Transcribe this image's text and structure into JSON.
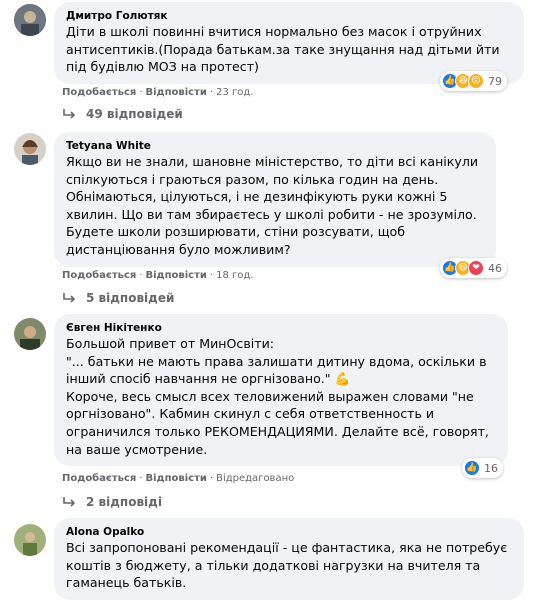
{
  "comments": [
    {
      "author": "Дмитро Голютяк",
      "text": "Діти в школі повинні вчитися нормально без масок і отруйних антисептиків.(Порада батькам.за таке знущання над дітьми йти під будівлю МОЗ на протест)",
      "like_label": "Подобається",
      "reply_label": "Відповісти",
      "time": "23 год.",
      "reaction_count": "79",
      "reactions": [
        "like",
        "haha",
        "wow"
      ],
      "replies_label": "49 відповідей"
    },
    {
      "author": "Tetyana White",
      "text": "Якщо ви не знали, шановне міністерство, то діти всі канікули спілкуються і граються разом, по кілька годин на день. Обнімаються, цілуються, і не дезинфікують руки кожні 5 хвилин. Що ви там збираєтесь у школі робити - не зрозуміло. Будете школи розширювати, стіни розсувати, щоб дистанціювання було можливим?",
      "like_label": "Подобається",
      "reply_label": "Відповісти",
      "time": "18 год.",
      "reaction_count": "46",
      "reactions": [
        "like",
        "haha",
        "love"
      ],
      "replies_label": "5 відповідей"
    },
    {
      "author": "Євген Нікітенко",
      "text": "Большой привет от МинОсвіти:\n\"... батьки не мають права залишати дитину вдома, оскільки в інший спосіб навчання не оргнізовано.\" 💪\nКороче, весь смысл всех теловижений выражен словами \"не оргнізовано\". Кабмин скинул с себя ответственность и ограничился только РЕКОМЕНДАЦИЯМИ. Делайте всё, говорят, на ваше усмотрение.",
      "like_label": "Подобається",
      "reply_label": "Відповісти",
      "time": "Відредаговано",
      "reaction_count": "16",
      "reactions": [
        "like"
      ],
      "replies_label": "2 відповіді"
    },
    {
      "author": "Alona Opalko",
      "text": "Всі запропоновані рекомендації - це фантастика, яка не потребує коштів з бюджету, а тільки додаткові нагрузки на вчителя та гаманець батьків."
    }
  ],
  "colors": {
    "bubble": "#f0f2f5",
    "meta": "#65676b",
    "like": "#1877f2",
    "haha": "#f7b125",
    "love": "#f33e58"
  },
  "icons": [
    "reply-arrow-icon",
    "thumbs-up-icon",
    "haha-emoji-icon",
    "wow-emoji-icon",
    "love-emoji-icon"
  ]
}
